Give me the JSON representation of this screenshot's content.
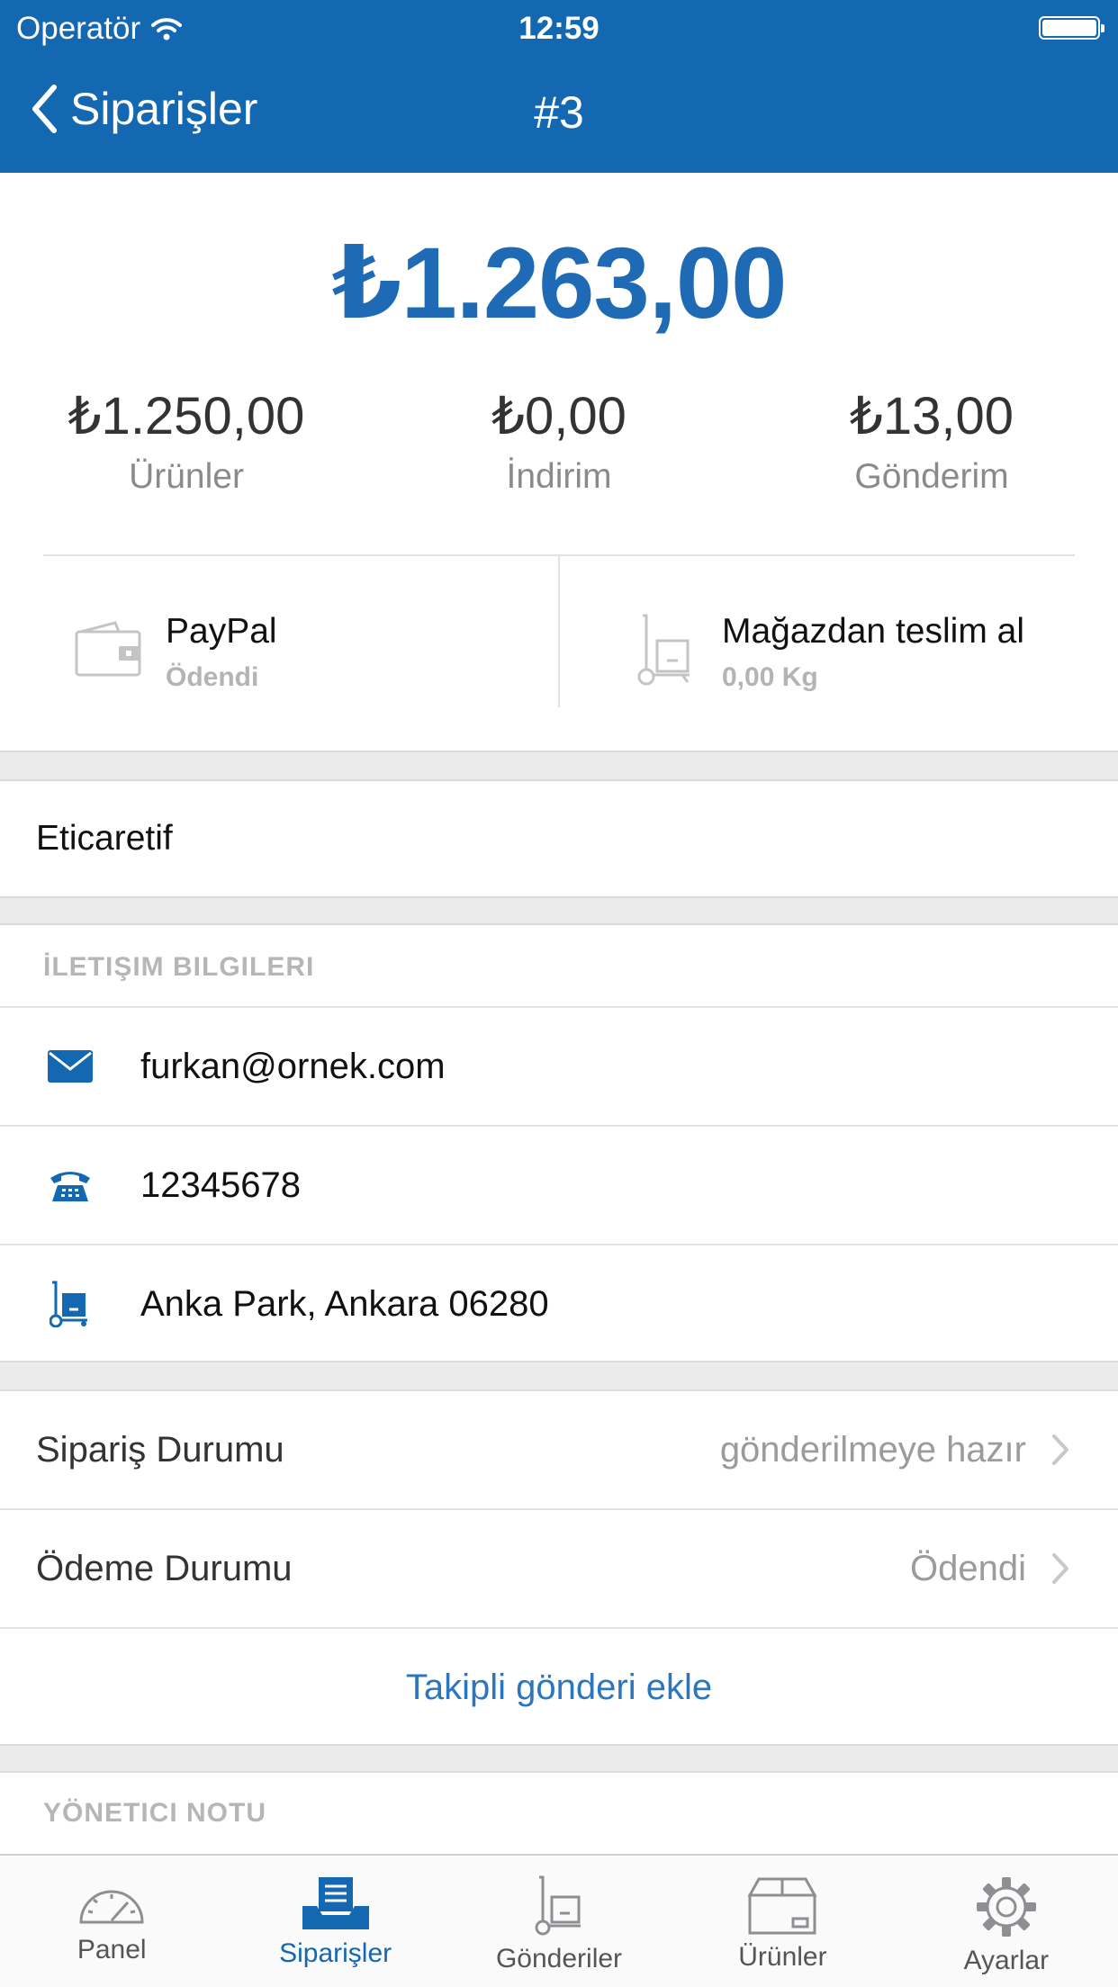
{
  "status_bar": {
    "carrier": "Operatör",
    "time": "12:59"
  },
  "nav": {
    "back_label": "Siparişler",
    "title": "#3"
  },
  "summary": {
    "total": "₺1.263,00",
    "stats": [
      {
        "amount": "₺1.250,00",
        "label": "Ürünler"
      },
      {
        "amount": "₺0,00",
        "label": "İndirim"
      },
      {
        "amount": "₺13,00",
        "label": "Gönderim"
      }
    ],
    "payment": {
      "method": "PayPal",
      "status": "Ödendi",
      "icon": "wallet-icon"
    },
    "shipping": {
      "method": "Mağazdan teslim al",
      "weight": "0,00 Kg",
      "icon": "hand-truck-icon"
    }
  },
  "customer_name": "Eticaretif",
  "contact": {
    "header": "İLETIŞIM BILGILERI",
    "email": "furkan@ornek.com",
    "phone": "12345678",
    "address": "Anka Park, Ankara 06280"
  },
  "order_status": {
    "label": "Sipariş Durumu",
    "value": "gönderilmeye hazır"
  },
  "payment_status": {
    "label": "Ödeme Durumu",
    "value": "Ödendi"
  },
  "add_tracking_label": "Takipli gönderi ekle",
  "admin_note_header": "YÖNETICI NOTU",
  "accent_color": "#1467b1",
  "tabs": [
    {
      "label": "Panel",
      "icon": "gauge-icon",
      "active": false
    },
    {
      "label": "Siparişler",
      "icon": "orders-tray-icon",
      "active": true
    },
    {
      "label": "Gönderiler",
      "icon": "hand-truck-icon",
      "active": false
    },
    {
      "label": "Ürünler",
      "icon": "box-icon",
      "active": false
    },
    {
      "label": "Ayarlar",
      "icon": "gear-icon",
      "active": false
    }
  ]
}
